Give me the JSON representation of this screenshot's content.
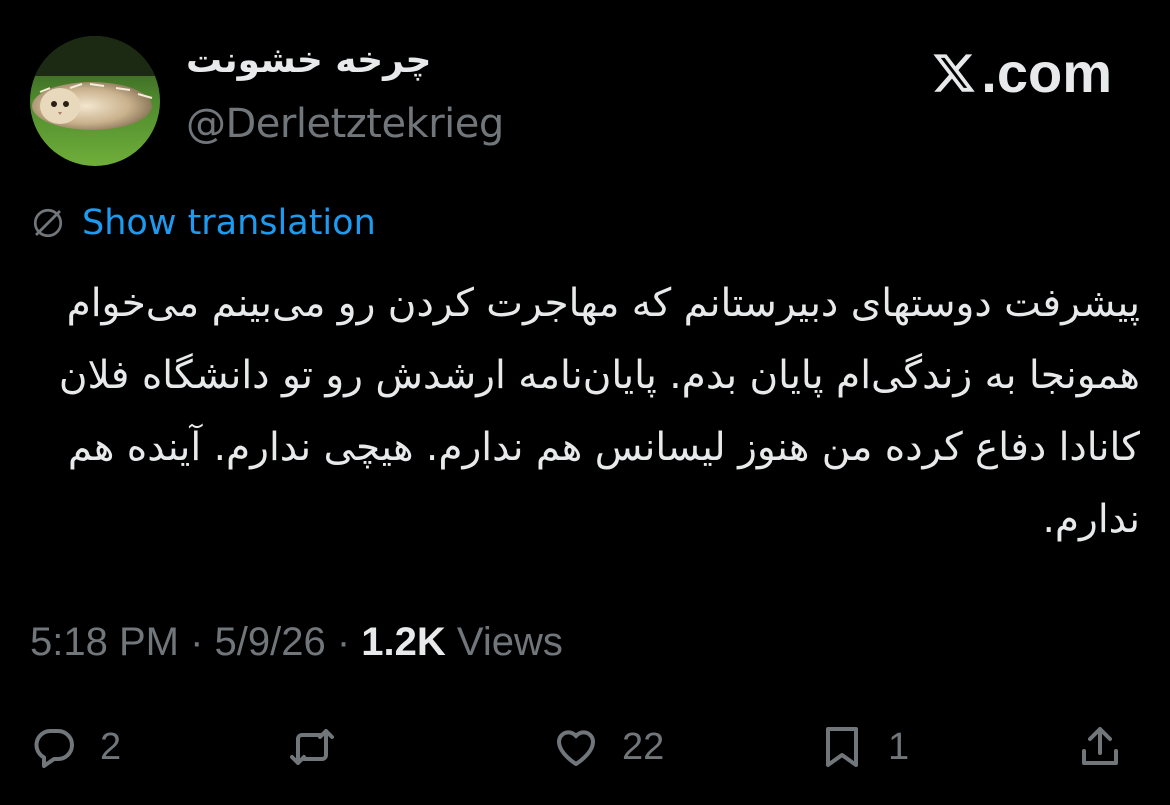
{
  "user": {
    "display_name": "چرخه خشونت",
    "handle": "@Derletztekrieg"
  },
  "brand": {
    "label": ".com"
  },
  "translate": {
    "label": "Show translation"
  },
  "tweet": {
    "text": "پیشرفت دوستهای دبیرستانم که مهاجرت کردن رو می‌بینم می‌خوام همونجا به زندگی‌ام پایان بدم. پایان‌نامه ارشدش رو تو دانشگاه فلان کانادا دفاع کرده من هنوز لیسانس هم ندارم. هیچی ندارم. آینده هم ندارم."
  },
  "meta": {
    "time": "5:18 PM",
    "separator": " · ",
    "date": "5/9/26",
    "views_count": "1.2K",
    "views_label": " Views"
  },
  "actions": {
    "reply_count": "2",
    "repost_count": "",
    "like_count": "22",
    "bookmark_count": "1"
  },
  "colors": {
    "background": "#000000",
    "text_primary": "#e7e9ea",
    "text_secondary": "#71767b",
    "link": "#1d9bf0"
  },
  "icons": [
    "globe-off-icon",
    "x-logo-icon",
    "reply-icon",
    "repost-icon",
    "like-icon",
    "bookmark-icon",
    "share-icon"
  ]
}
